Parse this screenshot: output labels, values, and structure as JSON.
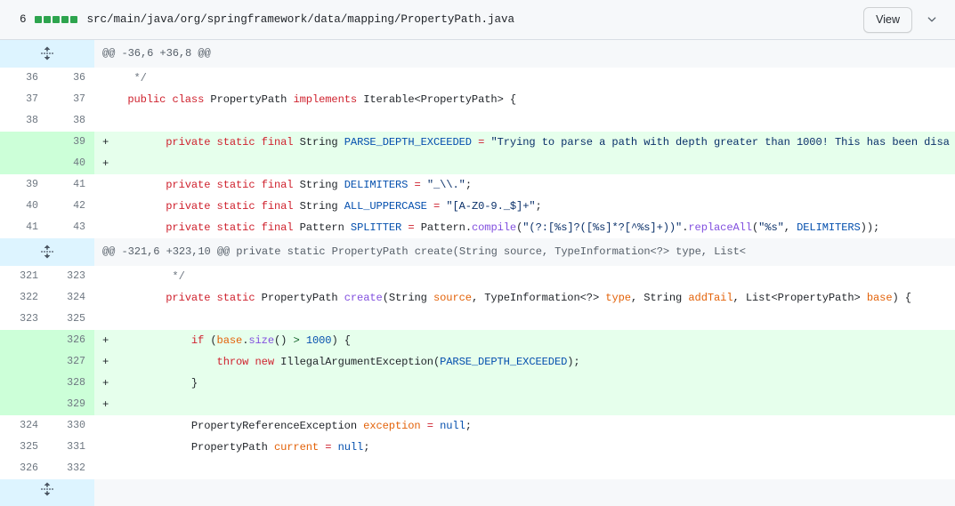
{
  "file_header": {
    "change_count": "6",
    "diffstat_blocks": [
      "add",
      "add",
      "add",
      "add",
      "add"
    ],
    "path": "src/main/java/org/springframework/data/mapping/PropertyPath.java",
    "view_label": "View",
    "chevron_icon": "chevron-down-icon"
  },
  "diff": {
    "expander_icon": "unfold-icon",
    "hunks": [
      {
        "header": "@@ -36,6 +36,8 @@",
        "rows": [
          {
            "type": "context",
            "old": "36",
            "new": "36",
            "marker": "",
            "code_plain": "   */"
          },
          {
            "type": "context",
            "old": "37",
            "new": "37",
            "marker": "",
            "code_plain": "  public class PropertyPath implements Iterable<PropertyPath> {"
          },
          {
            "type": "context",
            "old": "38",
            "new": "38",
            "marker": "",
            "code_plain": ""
          },
          {
            "type": "add",
            "old": "",
            "new": "39",
            "marker": "+",
            "code_plain": "        private static final String PARSE_DEPTH_EXCEEDED = \"Trying to parse a path with depth greater than 1000! This has been disa"
          },
          {
            "type": "add",
            "old": "",
            "new": "40",
            "marker": "+",
            "code_plain": ""
          },
          {
            "type": "context",
            "old": "39",
            "new": "41",
            "marker": "",
            "code_plain": "        private static final String DELIMITERS = \"_\\\\.\";"
          },
          {
            "type": "context",
            "old": "40",
            "new": "42",
            "marker": "",
            "code_plain": "        private static final String ALL_UPPERCASE = \"[A-Z0-9._$]+\";"
          },
          {
            "type": "context",
            "old": "41",
            "new": "43",
            "marker": "",
            "code_plain": "        private static final Pattern SPLITTER = Pattern.compile(\"(?:[%s]?([%s]*?[^%s]+))\".replaceAll(\"%s\", DELIMITERS));"
          }
        ]
      },
      {
        "header": "@@ -321,6 +323,10 @@ private static PropertyPath create(String source, TypeInformation<?> type, List<",
        "rows": [
          {
            "type": "context",
            "old": "321",
            "new": "323",
            "marker": "",
            "code_plain": "         */"
          },
          {
            "type": "context",
            "old": "322",
            "new": "324",
            "marker": "",
            "code_plain": "        private static PropertyPath create(String source, TypeInformation<?> type, String addTail, List<PropertyPath> base) {"
          },
          {
            "type": "context",
            "old": "323",
            "new": "325",
            "marker": "",
            "code_plain": ""
          },
          {
            "type": "add",
            "old": "",
            "new": "326",
            "marker": "+",
            "code_plain": "            if (base.size() > 1000) {"
          },
          {
            "type": "add",
            "old": "",
            "new": "327",
            "marker": "+",
            "code_plain": "                throw new IllegalArgumentException(PARSE_DEPTH_EXCEEDED);"
          },
          {
            "type": "add",
            "old": "",
            "new": "328",
            "marker": "+",
            "code_plain": "            }"
          },
          {
            "type": "add",
            "old": "",
            "new": "329",
            "marker": "+",
            "code_plain": ""
          },
          {
            "type": "context",
            "old": "324",
            "new": "330",
            "marker": "",
            "code_plain": "            PropertyReferenceException exception = null;"
          },
          {
            "type": "context",
            "old": "325",
            "new": "331",
            "marker": "",
            "code_plain": "            PropertyPath current = null;"
          },
          {
            "type": "context",
            "old": "326",
            "new": "332",
            "marker": "",
            "code_plain": ""
          }
        ]
      }
    ]
  },
  "colors": {
    "addition_bg": "#e6ffec",
    "addition_gutter_bg": "#ccffd8",
    "hunk_bg": "#f6f8fa",
    "expander_bg": "#ddf4ff",
    "diffstat_add": "#2da44e",
    "border": "#d8dee4",
    "keyword": "#cf222e",
    "constant": "#0550ae",
    "string": "#0a3069",
    "parameter": "#e36209",
    "function": "#8250df"
  }
}
